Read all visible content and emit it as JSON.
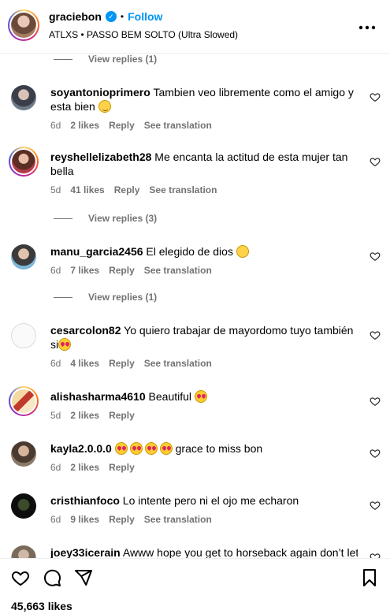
{
  "header": {
    "username": "graciebon",
    "separator": "•",
    "follow_label": "Follow",
    "song": "ATLXS • PASSO BEM SOLTO (Ultra Slowed)",
    "more_icon": "more-horizontal-icon"
  },
  "view_replies": [
    "View replies (1)",
    "View replies (3)",
    "View replies (1)"
  ],
  "comments": [
    {
      "username": "soyantonioprimero",
      "text": "Tambien veo libremente como el amigo y esta bien",
      "emoji": "wink",
      "time": "6d",
      "likes": "2 likes",
      "reply": "Reply",
      "translate": "See translation"
    },
    {
      "username": "reyshellelizabeth28",
      "text": "Me encanta la actitud de esta mujer tan bella",
      "emoji": "",
      "time": "5d",
      "likes": "41 likes",
      "reply": "Reply",
      "translate": "See translation"
    },
    {
      "username": "manu_garcia2456",
      "text": "El elegido de dios",
      "emoji": "scream",
      "time": "6d",
      "likes": "7 likes",
      "reply": "Reply",
      "translate": "See translation"
    },
    {
      "username": "cesarcolon82",
      "text": "Yo quiero trabajar de mayordomo tuyo también si",
      "emoji": "heart-eyes",
      "time": "6d",
      "likes": "4 likes",
      "reply": "Reply",
      "translate": "See translation"
    },
    {
      "username": "alishasharma4610",
      "text": "Beautiful",
      "emoji": "heart-eyes",
      "time": "5d",
      "likes": "2 likes",
      "reply": "Reply",
      "translate": ""
    },
    {
      "username": "kayla2.0.0.0",
      "text": "grace to miss bon",
      "emoji": "heart-eyes x4",
      "time": "6d",
      "likes": "2 likes",
      "reply": "Reply",
      "translate": ""
    },
    {
      "username": "cristhianfoco",
      "text": "Lo intente pero ni el ojo me echaron",
      "emoji": "",
      "time": "6d",
      "likes": "9 likes",
      "reply": "Reply",
      "translate": "See translation"
    },
    {
      "username": "joey33icerain",
      "text": "Awww hope you get to horseback again don’t let",
      "emoji": "",
      "time": "",
      "likes": "",
      "reply": "",
      "translate": ""
    }
  ],
  "footer": {
    "likes": "45,663 likes",
    "icons": [
      "heart-icon",
      "comment-icon",
      "share-icon",
      "bookmark-icon"
    ]
  },
  "colors": {
    "link_blue": "#0095f6",
    "secondary_text": "#737373",
    "divider": "#efefef"
  }
}
